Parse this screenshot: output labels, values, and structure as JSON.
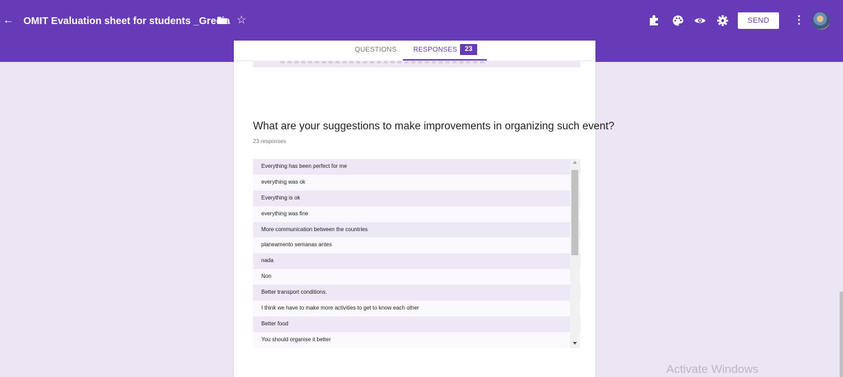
{
  "header": {
    "title": "OMIT Evaluation sheet for students _Grecia",
    "send_label": "SEND",
    "icons": [
      "back-arrow-icon",
      "folder-icon",
      "star-icon",
      "addon-puzzle-icon",
      "palette-icon",
      "preview-eye-icon",
      "settings-gear-icon",
      "more-vert-icon",
      "avatar"
    ],
    "colors": {
      "brand": "#673ab7",
      "background": "#ece6f4"
    }
  },
  "tabs": {
    "questions_label": "QUESTIONS",
    "responses_label": "RESPONSES",
    "responses_count": "23"
  },
  "question": {
    "title": "What are your suggestions to make improvements in organizing such event?",
    "responses_text": "23 responses",
    "answers": [
      "Everything has been perfect for me",
      "everything was ok",
      "Everything is ok",
      "everything was fine",
      "More communication between the countries",
      "planeamento semanas antes",
      "nada",
      "Non",
      "Better transport conditions.",
      "I think we have to make more activities to get to know each other",
      "Better food",
      "You should organise it better"
    ]
  },
  "os": {
    "watermark": "Activate Windows"
  }
}
